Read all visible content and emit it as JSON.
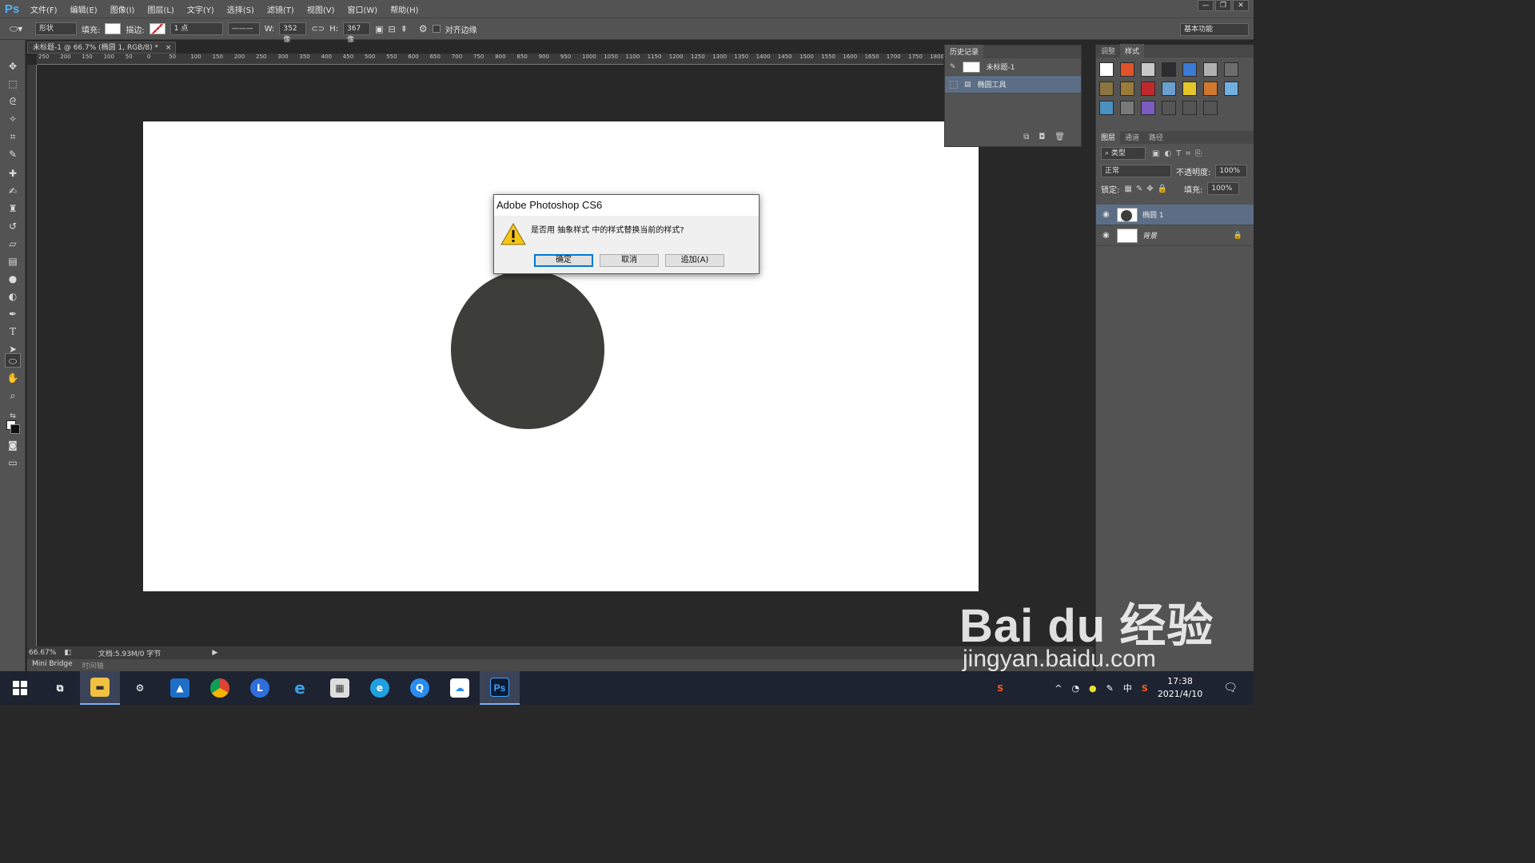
{
  "app": {
    "logo": "Ps",
    "menu": [
      "文件(F)",
      "编辑(E)",
      "图像(I)",
      "图层(L)",
      "文字(Y)",
      "选择(S)",
      "滤镜(T)",
      "视图(V)",
      "窗口(W)",
      "帮助(H)"
    ],
    "window_controls": [
      "—",
      "❐",
      "✕"
    ]
  },
  "options": {
    "mode": "形状",
    "fill_label": "填充:",
    "stroke_label": "描边:",
    "stroke_width": "1 点",
    "w_label": "W:",
    "w_value": "352 像",
    "h_label": "H:",
    "h_value": "367 像",
    "align_edges": "对齐边缘",
    "workspace": "基本功能"
  },
  "document": {
    "tab_title": "未标题-1 @ 66.7% (椭圆 1, RGB/8) *",
    "shape_color": "#3d3d3a",
    "ruler_ticks": [
      "250",
      "200",
      "150",
      "100",
      "50",
      "0",
      "50",
      "100",
      "150",
      "200",
      "250",
      "300",
      "350",
      "400",
      "450",
      "500",
      "550",
      "600",
      "650",
      "700",
      "750",
      "800",
      "850",
      "900",
      "950",
      "1000",
      "1050",
      "1100",
      "1150",
      "1200",
      "1250",
      "1300",
      "1350",
      "1400",
      "1450",
      "1500",
      "1550",
      "1600",
      "1650",
      "1700",
      "1750",
      "1800"
    ]
  },
  "status": {
    "zoom": "66.67%",
    "doc_info": "文档:5.93M/0 字节",
    "tabs": [
      "Mini Bridge",
      "时间轴"
    ]
  },
  "history": {
    "title": "历史记录",
    "items": [
      "未标题-1",
      "椭圆工具"
    ]
  },
  "styles_panel": {
    "tabs": [
      "调整",
      "样式"
    ],
    "swatch_colors": [
      "#ffffff",
      "#e0522a",
      "#c9c9c9",
      "#2d2d2d",
      "#3a7bd5",
      "#b0b0b0",
      "#6d6d6d",
      "#8a7440",
      "#9b7b3a",
      "#c0282c",
      "#6a9fd0",
      "#e3c628",
      "#d07830",
      "#6fb0e0",
      "#4a90c0",
      "#7a7a7a",
      "#7b5cc0",
      "#555555",
      "#555555",
      "#555555"
    ]
  },
  "layers_panel": {
    "tabs": [
      "图层",
      "通道",
      "路径"
    ],
    "filter": "类型",
    "blend_mode": "正常",
    "opacity_label": "不透明度:",
    "opacity": "100%",
    "lock_label": "锁定:",
    "fill_label": "填充:",
    "fill": "100%",
    "layers": [
      "椭圆 1",
      "背景"
    ]
  },
  "dialog": {
    "title": "Adobe Photoshop CS6",
    "message": "是否用 抽象样式 中的样式替换当前的样式?",
    "buttons": [
      "确定",
      "取消",
      "追加(A)"
    ]
  },
  "taskbar": {
    "clock_time": "17:38",
    "clock_date": "2021/4/10",
    "ime": "中"
  },
  "watermark": {
    "brand": "Bai du 经验",
    "url": "jingyan.baidu.com"
  }
}
